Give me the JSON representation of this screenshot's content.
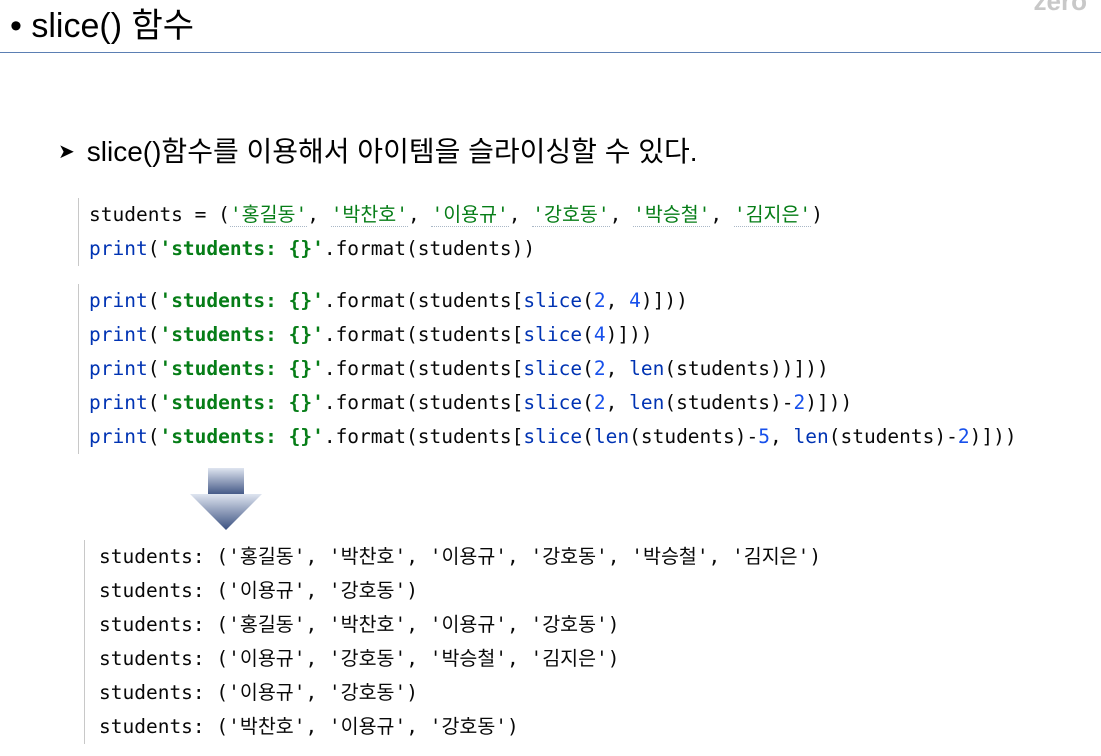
{
  "slide": {
    "title": "• slice() 함수",
    "corner_mark": "zero",
    "bullet_text": "slice()함수를 이용해서 아이템을 슬라이싱할 수 있다."
  },
  "code_block_1": {
    "lines": [
      {
        "tokens": [
          {
            "text": "students = (",
            "style": "plain"
          },
          {
            "text": "'홍길동'",
            "style": "str-u"
          },
          {
            "text": ", ",
            "style": "plain"
          },
          {
            "text": "'박찬호'",
            "style": "str-u"
          },
          {
            "text": ", ",
            "style": "plain"
          },
          {
            "text": "'이용규'",
            "style": "str-u"
          },
          {
            "text": ", ",
            "style": "plain"
          },
          {
            "text": "'강호동'",
            "style": "str-u"
          },
          {
            "text": ", ",
            "style": "plain"
          },
          {
            "text": "'박승철'",
            "style": "str-u"
          },
          {
            "text": ", ",
            "style": "plain"
          },
          {
            "text": "'김지은'",
            "style": "str-u"
          },
          {
            "text": ")",
            "style": "plain"
          }
        ]
      },
      {
        "tokens": [
          {
            "text": "print",
            "style": "fn"
          },
          {
            "text": "(",
            "style": "plain"
          },
          {
            "text": "'students: {}'",
            "style": "str"
          },
          {
            "text": ".format(students))",
            "style": "plain"
          }
        ]
      }
    ]
  },
  "code_block_2": {
    "lines": [
      {
        "tokens": [
          {
            "text": "print",
            "style": "fn"
          },
          {
            "text": "(",
            "style": "plain"
          },
          {
            "text": "'students: {}'",
            "style": "str"
          },
          {
            "text": ".format(students[",
            "style": "plain"
          },
          {
            "text": "slice",
            "style": "fn-b"
          },
          {
            "text": "(",
            "style": "plain"
          },
          {
            "text": "2",
            "style": "num"
          },
          {
            "text": ", ",
            "style": "plain"
          },
          {
            "text": "4",
            "style": "num"
          },
          {
            "text": ")]))",
            "style": "plain"
          }
        ]
      },
      {
        "tokens": [
          {
            "text": "print",
            "style": "fn"
          },
          {
            "text": "(",
            "style": "plain"
          },
          {
            "text": "'students: {}'",
            "style": "str"
          },
          {
            "text": ".format(students[",
            "style": "plain"
          },
          {
            "text": "slice",
            "style": "fn-b"
          },
          {
            "text": "(",
            "style": "plain"
          },
          {
            "text": "4",
            "style": "num"
          },
          {
            "text": ")]))",
            "style": "plain"
          }
        ]
      },
      {
        "tokens": [
          {
            "text": "print",
            "style": "fn"
          },
          {
            "text": "(",
            "style": "plain"
          },
          {
            "text": "'students: {}'",
            "style": "str"
          },
          {
            "text": ".format(students[",
            "style": "plain"
          },
          {
            "text": "slice",
            "style": "fn-b"
          },
          {
            "text": "(",
            "style": "plain"
          },
          {
            "text": "2",
            "style": "num"
          },
          {
            "text": ", ",
            "style": "plain"
          },
          {
            "text": "len",
            "style": "fn-b"
          },
          {
            "text": "(students))]))",
            "style": "plain"
          }
        ]
      },
      {
        "tokens": [
          {
            "text": "print",
            "style": "fn"
          },
          {
            "text": "(",
            "style": "plain"
          },
          {
            "text": "'students: {}'",
            "style": "str"
          },
          {
            "text": ".format(students[",
            "style": "plain"
          },
          {
            "text": "slice",
            "style": "fn-b"
          },
          {
            "text": "(",
            "style": "plain"
          },
          {
            "text": "2",
            "style": "num"
          },
          {
            "text": ", ",
            "style": "plain"
          },
          {
            "text": "len",
            "style": "fn-b"
          },
          {
            "text": "(students)-",
            "style": "plain"
          },
          {
            "text": "2",
            "style": "num"
          },
          {
            "text": ")]))",
            "style": "plain"
          }
        ]
      },
      {
        "tokens": [
          {
            "text": "print",
            "style": "fn"
          },
          {
            "text": "(",
            "style": "plain"
          },
          {
            "text": "'students: {}'",
            "style": "str"
          },
          {
            "text": ".format(students[",
            "style": "plain"
          },
          {
            "text": "slice",
            "style": "fn-b"
          },
          {
            "text": "(",
            "style": "plain"
          },
          {
            "text": "len",
            "style": "fn-b"
          },
          {
            "text": "(students)-",
            "style": "plain"
          },
          {
            "text": "5",
            "style": "num"
          },
          {
            "text": ", ",
            "style": "plain"
          },
          {
            "text": "len",
            "style": "fn-b"
          },
          {
            "text": "(students)-",
            "style": "plain"
          },
          {
            "text": "2",
            "style": "num"
          },
          {
            "text": ")]))",
            "style": "plain"
          }
        ]
      }
    ]
  },
  "output": {
    "lines": [
      "students: ('홍길동', '박찬호', '이용규', '강호동', '박승철', '김지은')",
      "students: ('이용규', '강호동')",
      "students: ('홍길동', '박찬호', '이용규', '강호동')",
      "students: ('이용규', '강호동', '박승철', '김지은')",
      "students: ('이용규', '강호동')",
      "students: ('박찬호', '이용규', '강호동')"
    ]
  },
  "colors": {
    "title_rule": "#5b7fb3",
    "string": "#067d17",
    "function": "#0033b3",
    "number": "#1750eb",
    "arrow_top": "#c9d3e6",
    "arrow_bottom": "#344a7a"
  }
}
